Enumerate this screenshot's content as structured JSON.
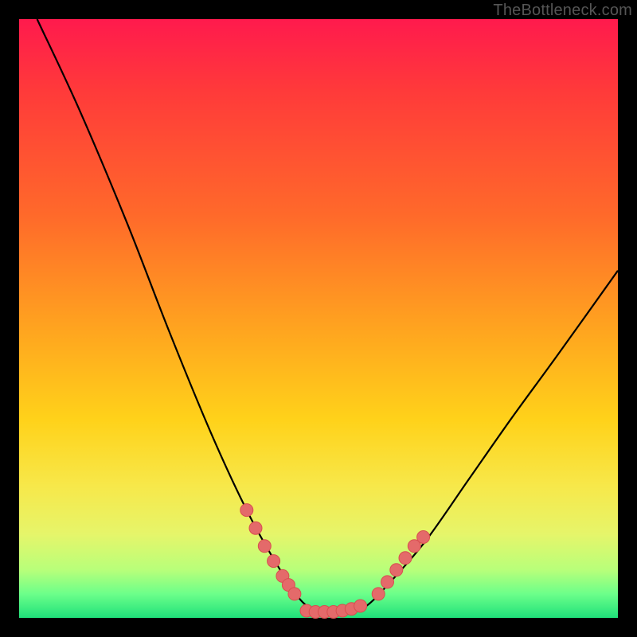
{
  "watermark": "TheBottleneck.com",
  "chart_data": {
    "type": "line",
    "title": "",
    "xlabel": "",
    "ylabel": "",
    "xlim": [
      0,
      100
    ],
    "ylim": [
      0,
      100
    ],
    "series": [
      {
        "name": "bottleneck-curve",
        "x": [
          3,
          10,
          18,
          25,
          32,
          38,
          43,
          47,
          50,
          52,
          55,
          58,
          62,
          68,
          75,
          82,
          90,
          100
        ],
        "values": [
          100,
          85,
          66,
          48,
          31,
          18,
          9,
          3,
          1,
          1,
          1,
          2,
          6,
          13,
          23,
          33,
          44,
          58
        ]
      }
    ],
    "marker_groups": [
      {
        "name": "left-cluster",
        "x": [
          38,
          39.5,
          41,
          42.5,
          44,
          45,
          46
        ],
        "values": [
          18,
          15,
          12,
          9.5,
          7,
          5.5,
          4
        ]
      },
      {
        "name": "bottom-cluster",
        "x": [
          48,
          49.5,
          51,
          52.5,
          54,
          55.5,
          57
        ],
        "values": [
          1.2,
          1,
          1,
          1,
          1.2,
          1.5,
          2
        ]
      },
      {
        "name": "right-cluster",
        "x": [
          60,
          61.5,
          63,
          64.5,
          66,
          67.5
        ],
        "values": [
          4,
          6,
          8,
          10,
          12,
          13.5
        ]
      }
    ],
    "colors": {
      "curve": "#000000",
      "marker_fill": "#e46a6a",
      "marker_stroke": "#d84f4f"
    }
  }
}
